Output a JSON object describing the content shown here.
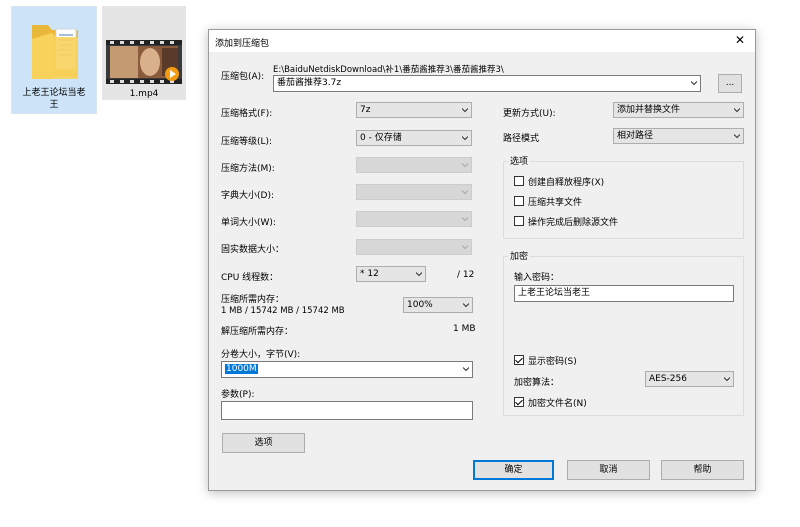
{
  "desktop": {
    "icons": [
      {
        "label": "上老王论坛当老\n王",
        "icon": "folder-icon"
      },
      {
        "label": "1.mp4",
        "icon": "video-thumbnail-icon"
      }
    ]
  },
  "dialog": {
    "title": "添加到压缩包",
    "archive": {
      "label": "压缩包(A):",
      "path": "E:\\BaiduNetdiskDownload\\补1\\番茄酱推荐3\\番茄酱推荐3\\",
      "filename": "番茄酱推荐3.7z",
      "browse_label": "..."
    },
    "left": {
      "format": {
        "label": "压缩格式(F):",
        "value": "7z"
      },
      "level": {
        "label": "压缩等级(L):",
        "value": "0 - 仅存储"
      },
      "method": {
        "label": "压缩方法(M):",
        "value": ""
      },
      "dict_size": {
        "label": "字典大小(D):",
        "value": ""
      },
      "word_size": {
        "label": "单词大小(W):",
        "value": ""
      },
      "solid_size": {
        "label": "固实数据大小：",
        "value": ""
      },
      "cpu_threads": {
        "label": "CPU 线程数：",
        "value": "* 12",
        "max": "/ 12"
      },
      "mem_compress": {
        "label": "压缩所需内存：",
        "detail": "1 MB / 15742 MB / 15742 MB",
        "percent": "100%"
      },
      "mem_decompress": {
        "label": "解压缩所需内存：",
        "value": "1 MB"
      },
      "volume": {
        "label": "分卷大小，字节(V):",
        "value": "1000M"
      },
      "params": {
        "label": "参数(P):",
        "value": ""
      },
      "options_button": "选项"
    },
    "right": {
      "update_mode": {
        "label": "更新方式(U):",
        "value": "添加并替换文件"
      },
      "path_mode": {
        "label": "路径模式",
        "value": "相对路径"
      },
      "options_group": {
        "title": "选项",
        "sfx": {
          "label": "创建自释放程序(X)",
          "checked": false
        },
        "shared": {
          "label": "压缩共享文件",
          "checked": false
        },
        "delete_after": {
          "label": "操作完成后删除源文件",
          "checked": false
        }
      },
      "encryption_group": {
        "title": "加密",
        "password_label": "输入密码：",
        "password_value": "上老王论坛当老王",
        "show_password": {
          "label": "显示密码(S)",
          "checked": true
        },
        "method_label": "加密算法：",
        "method_value": "AES-256",
        "encrypt_names": {
          "label": "加密文件名(N)",
          "checked": true
        }
      }
    },
    "buttons": {
      "ok": "确定",
      "cancel": "取消",
      "help": "帮助"
    }
  }
}
